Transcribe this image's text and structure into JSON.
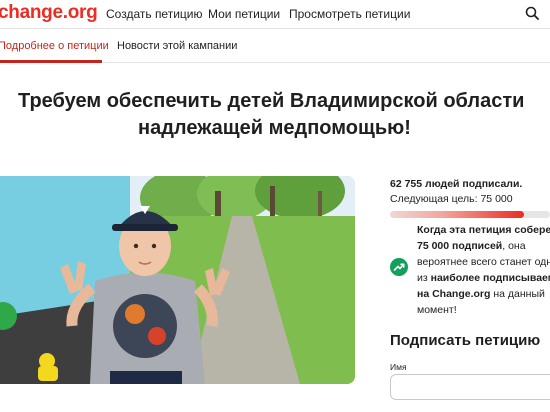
{
  "nav": {
    "logo": "change.org",
    "links": [
      "Создать петицию",
      "Мои петиции",
      "Просмотреть петиции"
    ]
  },
  "tabs": {
    "active": "Подробнее о петиции",
    "other": "Новости этой кампании"
  },
  "petition": {
    "title_line1": "Требуем обеспечить детей Владимирской области",
    "title_line2": "надлежащей медпомощью!"
  },
  "stats": {
    "signed": "62 755 людей подписали.",
    "goal": "Следующая цель: 75 000",
    "progress_fraction": 0.837
  },
  "note": {
    "p1": "Когда эта петиция соберет",
    "p2": "75 000 подписей",
    "p3": ", она",
    "p4": "вероятнее всего станет одной",
    "p5": "из",
    "p6": "наиболее подписываемых",
    "p7": "на Change.org",
    "p8": "на данный",
    "p9": "момент!"
  },
  "sign": {
    "title": "Подписать петицию",
    "name_label": "Имя"
  },
  "colors": {
    "brand": "#ec2c22",
    "accent": "#c5251c",
    "trend": "#12a05c"
  },
  "icons": {
    "search": "search-icon",
    "trend": "trend-up-icon"
  }
}
